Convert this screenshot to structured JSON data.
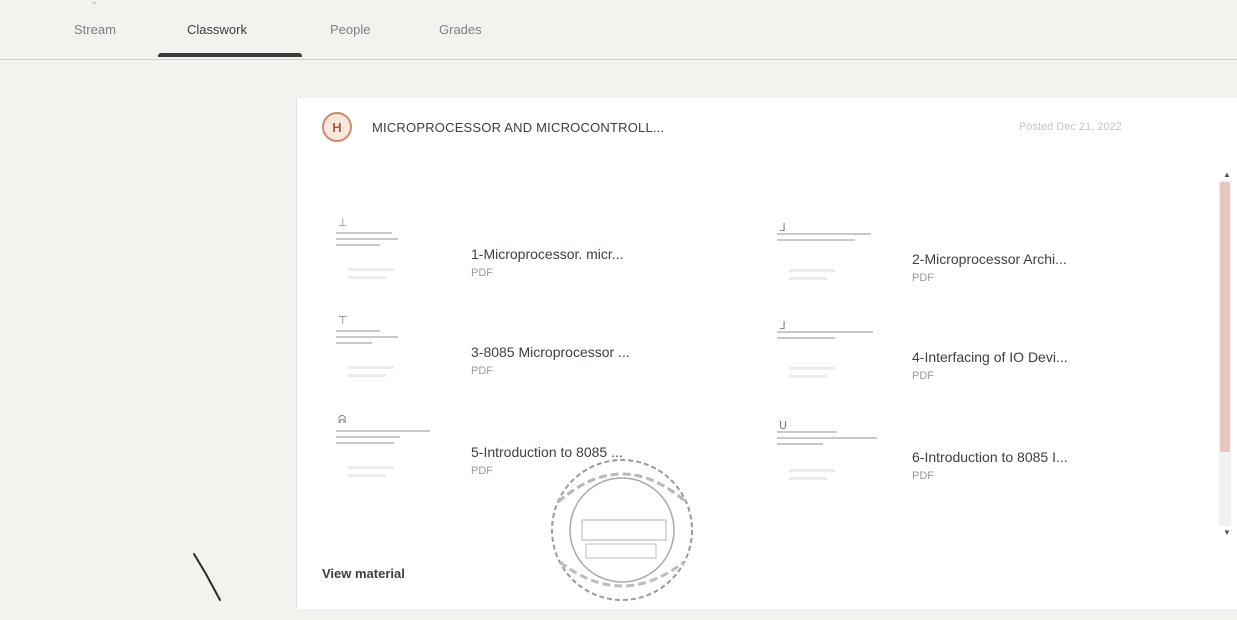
{
  "tabs": [
    {
      "label": "Stream"
    },
    {
      "label": "Classwork"
    },
    {
      "label": "People"
    },
    {
      "label": "Grades"
    }
  ],
  "active_tab": "Classwork",
  "post": {
    "course_title": "MICROPROCESSOR AND MICROCONTROLL...",
    "posted": "Posted Dec 21, 2022",
    "logo_letter": "H"
  },
  "materials": [
    {
      "title": "1-Microprocessor. micr...",
      "type": "PDF"
    },
    {
      "title": "2-Microprocessor Archi...",
      "type": "PDF"
    },
    {
      "title": "3-8085 Microprocessor ...",
      "type": "PDF"
    },
    {
      "title": "4-Interfacing of IO Devi...",
      "type": "PDF"
    },
    {
      "title": "5-Introduction to 8085 ...",
      "type": "PDF"
    },
    {
      "title": "6-Introduction to 8085 I...",
      "type": "PDF"
    }
  ],
  "actions": {
    "view_material": "View material"
  },
  "colors": {
    "accent_logo": "#c98b6a",
    "scroll_thumb": "#e6c5bd",
    "active_underline": "#3a3a3a"
  }
}
